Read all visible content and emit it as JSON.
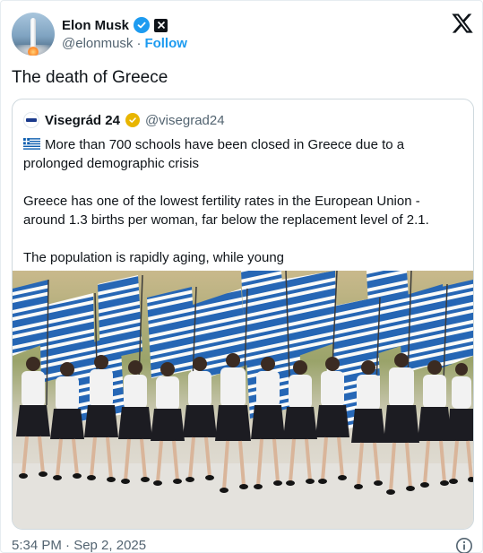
{
  "author": {
    "name": "Elon Musk",
    "handle": "@elonmusk",
    "separator": "·",
    "follow_label": "Follow",
    "avatar_icon": "rocket-launch-avatar",
    "verified_icon": "verified-badge-icon",
    "affiliate_icon": "x-affiliate-badge-icon"
  },
  "tweet": {
    "text": "The death of Greece",
    "timestamp": "5:34 PM · Sep 2, 2025"
  },
  "quoted": {
    "name": "Visegrád 24",
    "handle": "@visegrad24",
    "badge_icon": "gold-verified-badge-icon",
    "flag_icon": "greece-flag-icon",
    "line1": "More than 700 schools have been closed in Greece due to a prolonged demographic crisis",
    "line2": "Greece has one of the lowest fertility rates in the European Union - around 1.3 births per woman, far below the replacement level of 2.1.",
    "line3": "The population is rapidly aging, while young",
    "image_subject": "parade of students in white shirts and black skirts carrying Greek flags"
  },
  "colors": {
    "accent": "#1d9bf0",
    "text": "#0f1419",
    "muted": "#536471",
    "border": "#cfd9de",
    "gold": "#e8b500",
    "greek_blue": "#0d5eaf"
  }
}
